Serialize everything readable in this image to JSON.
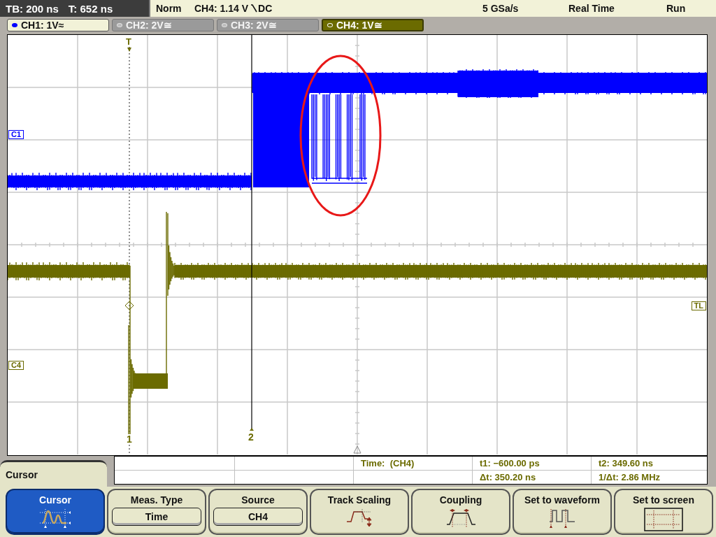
{
  "status_bar": {
    "timebase": "TB: 200 ns",
    "trigger_time": "T: 652 ns",
    "trigger_mode": "Norm",
    "trigger_level": "CH4: 1.14 V",
    "trigger_coupling": "DC",
    "sample_rate": "5 GSa/s",
    "acquisition": "Real Time",
    "run_state": "Run"
  },
  "channels": [
    {
      "label": "CH1: 1V≈",
      "on": true,
      "selected": false
    },
    {
      "label": "CH2: 2V≅",
      "on": false,
      "selected": false
    },
    {
      "label": "CH3: 2V≅",
      "on": false,
      "selected": false
    },
    {
      "label": "CH4: 1V≅",
      "on": true,
      "selected": true
    }
  ],
  "graticule": {
    "channel_markers": [
      "C1",
      "C4"
    ],
    "trigger_level_marker": "TL",
    "trigger_marker": "T",
    "cursor_markers": [
      "1",
      "2"
    ]
  },
  "menu_title": "Cursor",
  "measurements": {
    "title": "Time:  (CH4)",
    "cells": [
      "t1: −600.00 ps",
      "t2: 349.60 ns",
      "Δt: 350.20 ns",
      "1/Δt: 2.86 MHz"
    ]
  },
  "softkeys": [
    {
      "label": "Cursor",
      "kind": "icon",
      "selected": true
    },
    {
      "label": "Meas. Type",
      "kind": "value",
      "value": "Time",
      "selected": false
    },
    {
      "label": "Source",
      "kind": "value",
      "value": "CH4",
      "selected": false
    },
    {
      "label": "Track Scaling",
      "kind": "icon",
      "selected": false
    },
    {
      "label": "Coupling",
      "kind": "icon",
      "selected": false
    },
    {
      "label": "Set to waveform",
      "kind": "icon",
      "selected": false
    },
    {
      "label": "Set to screen",
      "kind": "icon",
      "selected": false
    }
  ]
}
